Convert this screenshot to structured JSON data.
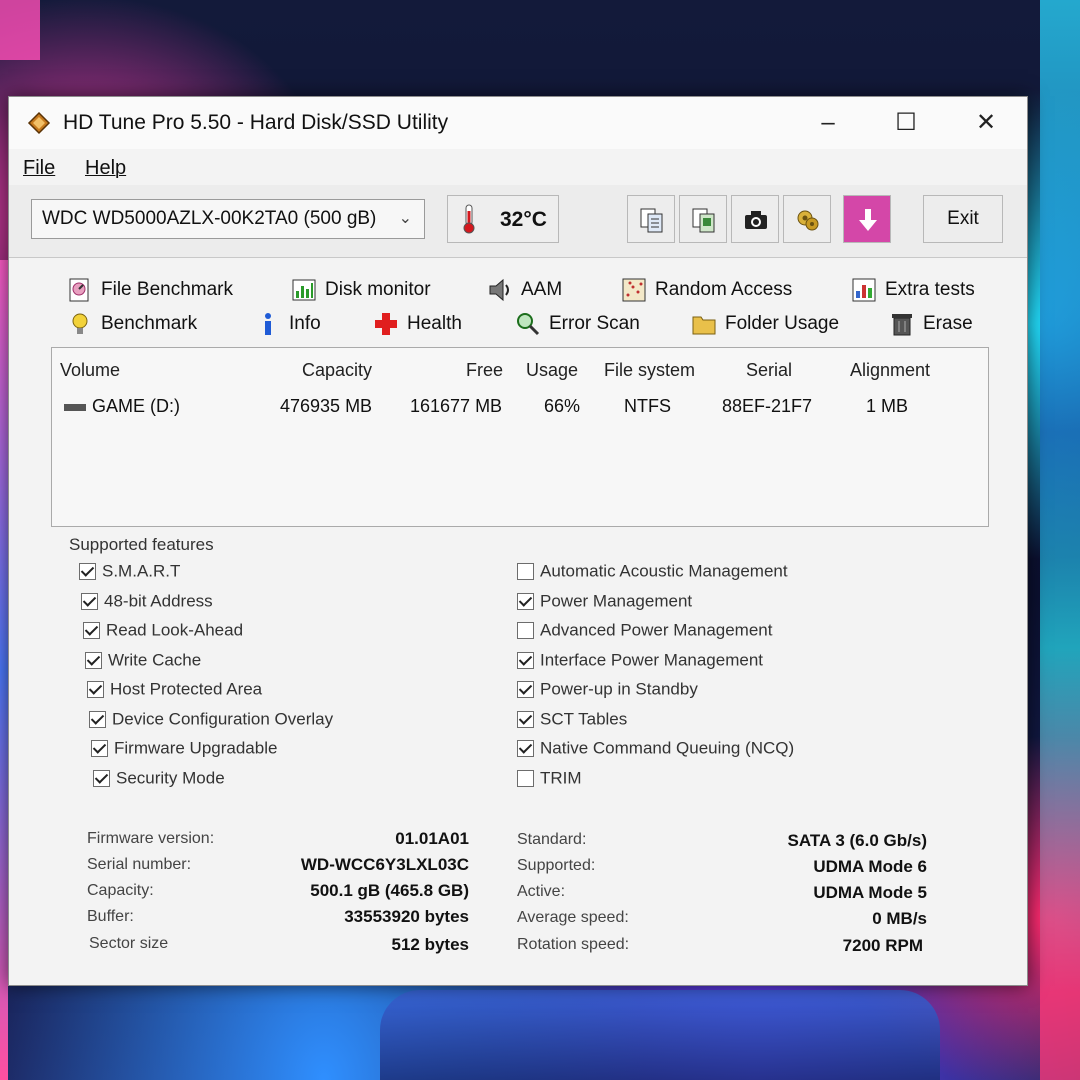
{
  "window": {
    "title": "HD Tune Pro 5.50 - Hard Disk/SSD Utility",
    "minimize": "–",
    "maximize": "☐",
    "close": "✕"
  },
  "menu": {
    "file": "File",
    "help": "Help"
  },
  "toolbar": {
    "drive": "WDC WD5000AZLX-00K2TA0 (500 gB)",
    "temperature": "32°C",
    "exit_label": "Exit",
    "buttons": [
      "copy-text-icon",
      "copy-screenshot-icon",
      "camera-icon",
      "options-icon",
      "save-icon"
    ]
  },
  "tabs": {
    "row1": [
      "File Benchmark",
      "Disk monitor",
      "AAM",
      "Random Access",
      "Extra tests"
    ],
    "row2": [
      "Benchmark",
      "Info",
      "Health",
      "Error Scan",
      "Folder Usage",
      "Erase"
    ]
  },
  "volumes": {
    "headers": [
      "Volume",
      "Capacity",
      "Free",
      "Usage",
      "File system",
      "Serial",
      "Alignment"
    ],
    "rows": [
      {
        "volume": "GAME (D:)",
        "capacity": "476935 MB",
        "free": "161677 MB",
        "usage": "66%",
        "fs": "NTFS",
        "serial": "88EF-21F7",
        "alignment": "1 MB"
      }
    ]
  },
  "features": {
    "title": "Supported features",
    "left": [
      {
        "label": "S.M.A.R.T",
        "checked": true
      },
      {
        "label": "48-bit Address",
        "checked": true
      },
      {
        "label": "Read Look-Ahead",
        "checked": true
      },
      {
        "label": "Write Cache",
        "checked": true
      },
      {
        "label": "Host Protected Area",
        "checked": true
      },
      {
        "label": "Device Configuration Overlay",
        "checked": true
      },
      {
        "label": "Firmware Upgradable",
        "checked": true
      },
      {
        "label": "Security Mode",
        "checked": true
      }
    ],
    "right": [
      {
        "label": "Automatic Acoustic Management",
        "checked": false
      },
      {
        "label": "Power Management",
        "checked": true
      },
      {
        "label": "Advanced Power Management",
        "checked": false
      },
      {
        "label": "Interface Power Management",
        "checked": true
      },
      {
        "label": "Power-up in Standby",
        "checked": true
      },
      {
        "label": "SCT Tables",
        "checked": true
      },
      {
        "label": "Native Command Queuing (NCQ)",
        "checked": true
      },
      {
        "label": "TRIM",
        "checked": false
      }
    ]
  },
  "info": {
    "left": [
      {
        "label": "Firmware version:",
        "value": "01.01A01"
      },
      {
        "label": "Serial number:",
        "value": "WD-WCC6Y3LXL03C"
      },
      {
        "label": "Capacity:",
        "value": "500.1 gB (465.8 GB)"
      },
      {
        "label": "Buffer:",
        "value": "33553920 bytes"
      },
      {
        "label": "Sector size",
        "value": "512 bytes"
      }
    ],
    "right": [
      {
        "label": "Standard:",
        "value": "SATA 3 (6.0 Gb/s)"
      },
      {
        "label": "Supported:",
        "value": "UDMA Mode 6"
      },
      {
        "label": "Active:",
        "value": "UDMA Mode 5"
      },
      {
        "label": "Average speed:",
        "value": "0 MB/s"
      },
      {
        "label": "Rotation speed:",
        "value": "7200 RPM"
      }
    ]
  }
}
